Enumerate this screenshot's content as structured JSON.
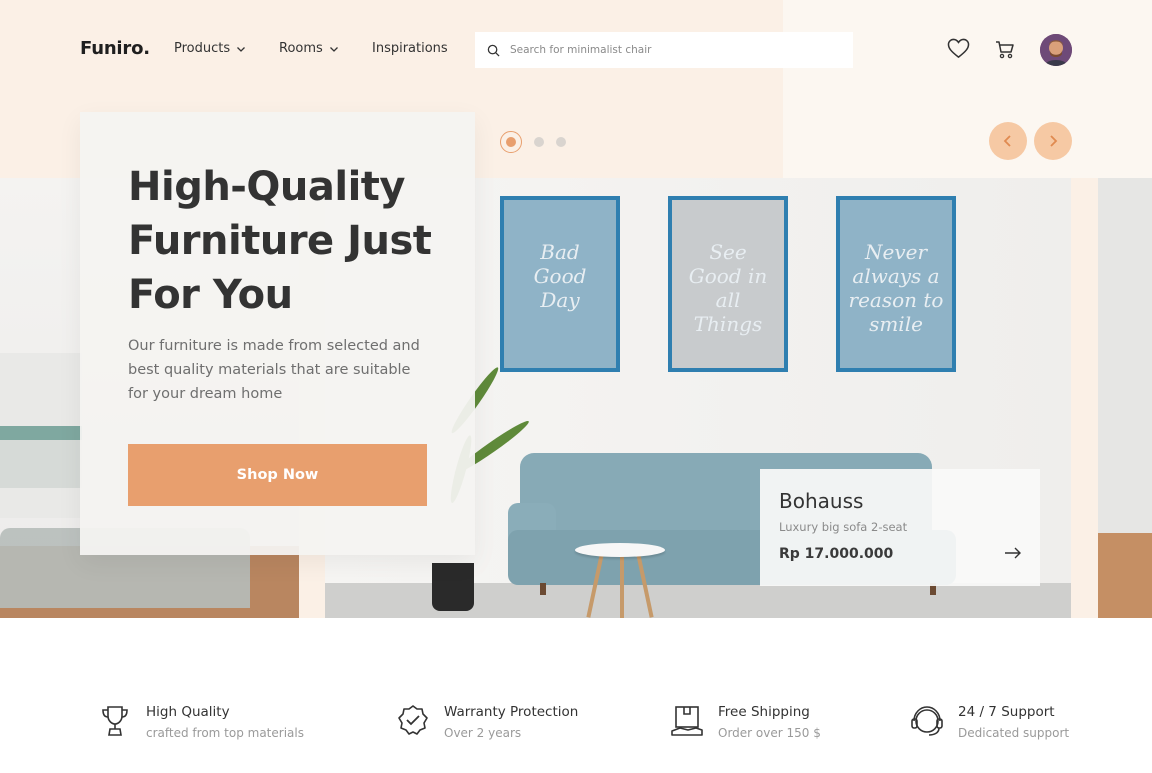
{
  "header": {
    "logo": "Funiro.",
    "nav": [
      {
        "label": "Products",
        "has_dropdown": true
      },
      {
        "label": "Rooms",
        "has_dropdown": true
      },
      {
        "label": "Inspirations",
        "has_dropdown": false
      }
    ],
    "search": {
      "placeholder": "Search for minimalist chair",
      "value": "",
      "icon": "search-icon"
    },
    "icons": [
      "heart-icon",
      "cart-icon"
    ],
    "avatar": "user-avatar"
  },
  "hero": {
    "title_lines": [
      "High-Quality",
      "Furniture Just",
      "For You"
    ],
    "description": "Our furniture is made from selected and best quality materials that are suitable for your dream home",
    "cta_label": "Shop Now",
    "carousel": {
      "slides": 3,
      "active": 1
    },
    "arrows": [
      "chevron-left-icon",
      "chevron-right-icon"
    ],
    "frames": [
      {
        "text": "Bad Good Day"
      },
      {
        "text": "See Good in all Things"
      },
      {
        "text": "Never always a reason to smile"
      }
    ]
  },
  "product": {
    "name": "Bohauss",
    "subtitle": "Luxury big sofa 2-seat",
    "price": "Rp 17.000.000"
  },
  "features": [
    {
      "icon": "trophy-icon",
      "title": "High Quality",
      "subtitle": "crafted from top materials"
    },
    {
      "icon": "badge-check-icon",
      "title": "Warranty Protection",
      "subtitle": "Over 2 years"
    },
    {
      "icon": "shipping-box-icon",
      "title": "Free Shipping",
      "subtitle": "Order over 150 $"
    },
    {
      "icon": "headset-icon",
      "title": "24 / 7 Support",
      "subtitle": "Dedicated support"
    }
  ],
  "colors": {
    "accent": "#E89F6E",
    "peach_bg": "#FBF0E6",
    "frame_blue": "#2F7FB0"
  }
}
